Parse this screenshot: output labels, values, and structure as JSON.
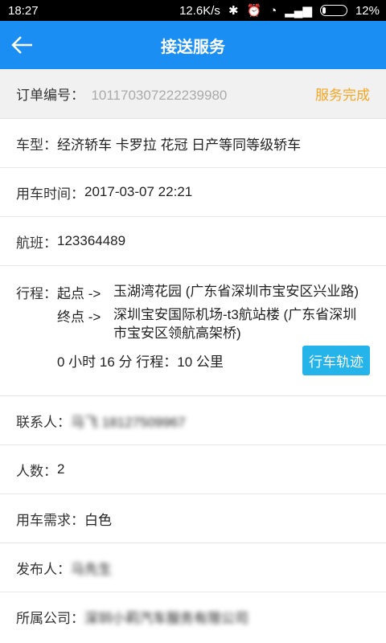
{
  "status": {
    "time": "18:27",
    "speed": "12.6K/s",
    "battery": "12%"
  },
  "appbar": {
    "title": "接送服务"
  },
  "order": {
    "label": "订单编号：",
    "number": "101170307222239980",
    "status": "服务完成"
  },
  "car_type": {
    "label": "车型：",
    "value": "经济轿车 卡罗拉 花冠 日产等同等级轿车"
  },
  "use_time": {
    "label": "用车时间：",
    "value": "2017-03-07 22:21"
  },
  "flight": {
    "label": "航班：",
    "value": "123364489"
  },
  "trip": {
    "label": "行程：",
    "start_tag": "起点 ->",
    "start": "玉湖湾花园 (广东省深圳市宝安区兴业路)",
    "end_tag": "终点 ->",
    "end": "深圳宝安国际机场-t3航站楼 (广东省深圳市宝安区领航高架桥)",
    "summary": "0 小时 16 分 行程：10 公里",
    "track_button": "行车轨迹"
  },
  "contact": {
    "label": "联系人：",
    "value": "马飞 18127509967"
  },
  "people": {
    "label": "人数：",
    "value": "2"
  },
  "demand": {
    "label": "用车需求：",
    "value": "白色"
  },
  "publisher": {
    "label": "发布人：",
    "value": "马先生"
  },
  "company": {
    "label": "所属公司：",
    "value": "深圳小莉汽车服务有限公司"
  },
  "colors": {
    "appbar": "#1a8ef2",
    "status_orange": "#f5a623",
    "button": "#25b4ea"
  }
}
